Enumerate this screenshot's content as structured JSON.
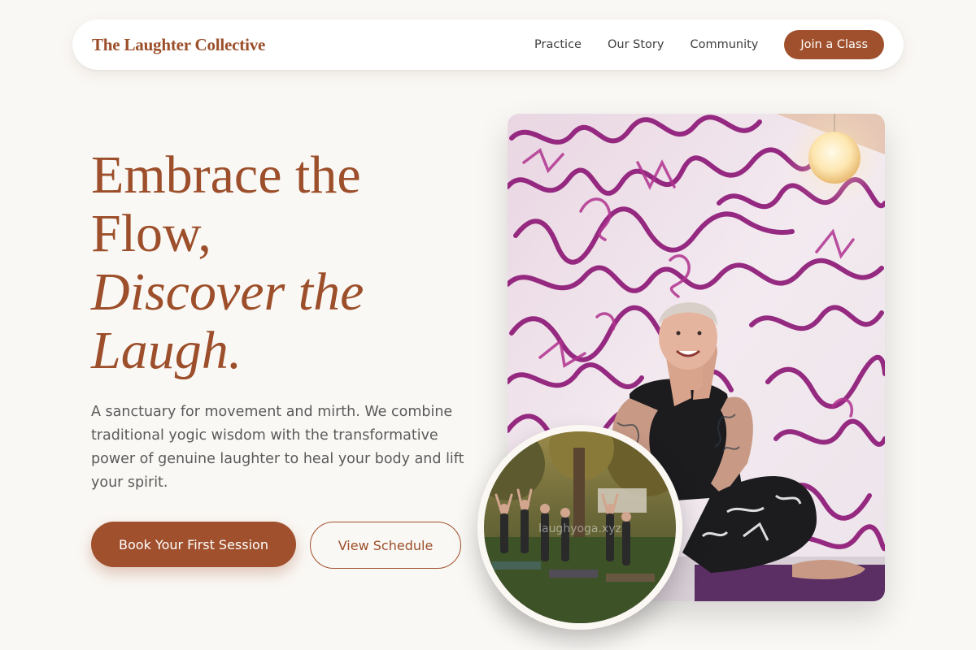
{
  "nav": {
    "brand": "The Laughter Collective",
    "links": [
      "Practice",
      "Our Story",
      "Community"
    ],
    "cta": "Join a Class"
  },
  "hero": {
    "headline_line1": "Embrace the",
    "headline_line2": "Flow,",
    "headline_line3": "Discover the",
    "headline_line4": "Laugh.",
    "lead": "A sanctuary for movement and mirth. We combine traditional yogic wisdom with the transformative power of genuine laughter to heal your body and lift your spirit.",
    "primary_button": "Book Your First Session",
    "secondary_button": "View Schedule"
  },
  "images": {
    "main_alt": "Tattooed yogi in prayer pose in front of a graffiti wall",
    "circle_alt": "Outdoor group yoga class in a park",
    "circle_watermark": "laughyoga.xyz"
  },
  "colors": {
    "accent": "#a0502c",
    "background": "#faf8f5",
    "graffiti": "#8e1a78"
  }
}
